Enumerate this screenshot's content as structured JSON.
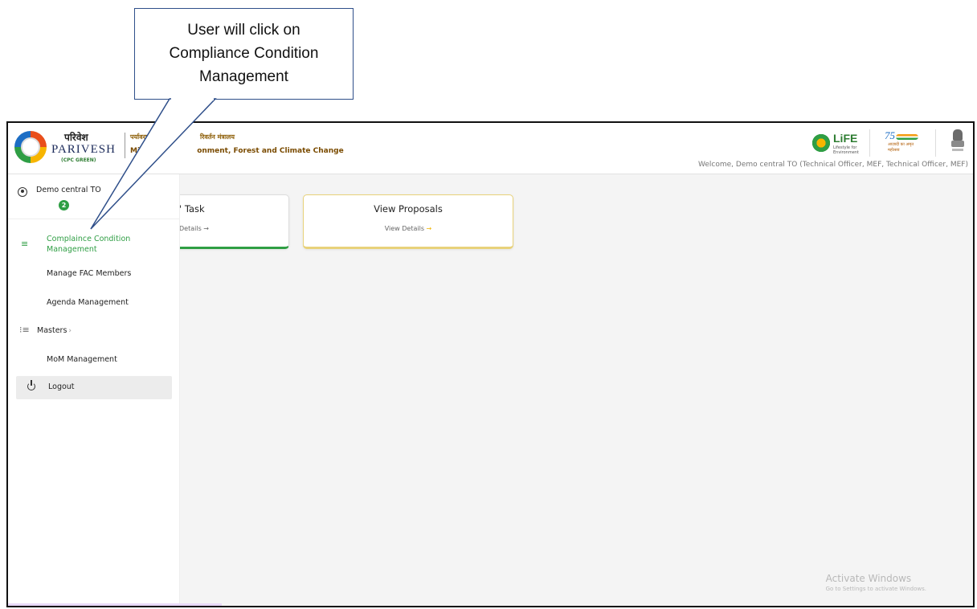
{
  "callout": {
    "line1": "User will click on",
    "line2": "Compliance Condition",
    "line3": "Management"
  },
  "header": {
    "brand_hindi": "परिवेश",
    "brand_english": "PARIVESH",
    "brand_sub": "(CPC GREEN)",
    "ministry_hindi": "पर्यावरण, व",
    "ministry_hindi_end": "रिवर्तन मंत्रालय",
    "ministry_english": "Minist",
    "ministry_english_end": "onment, Forest and Climate Change",
    "life_logo_text": "LiFE",
    "life_logo_tag": "Lifestyle for Environment",
    "azadi_text": "आज़ादी का अमृत महोत्सव",
    "welcome_text": "Welcome, Demo central TO (Technical Officer, MEF, Technical Officer, MEF)"
  },
  "sidebar": {
    "user_name": "Demo central TO",
    "badge_count": "2",
    "items": [
      {
        "label_line1": "Complaince Condition",
        "label_line2": "Management",
        "active": true
      },
      {
        "label": "Manage FAC Members"
      },
      {
        "label": "Agenda Management"
      },
      {
        "label": "Masters"
      },
      {
        "label": "MoM Management"
      }
    ],
    "logout_label": "Logout"
  },
  "cards": [
    {
      "title": "' Task",
      "link": "Details →"
    },
    {
      "title": "View Proposals",
      "link": "View Details",
      "arrow": "→"
    }
  ],
  "watermark": {
    "title": "Activate Windows",
    "subtitle": "Go to Settings to activate Windows."
  },
  "colors": {
    "accent_green": "#2f9e44",
    "accent_yellow": "#f5c400",
    "callout_border": "#2f4f8a"
  }
}
